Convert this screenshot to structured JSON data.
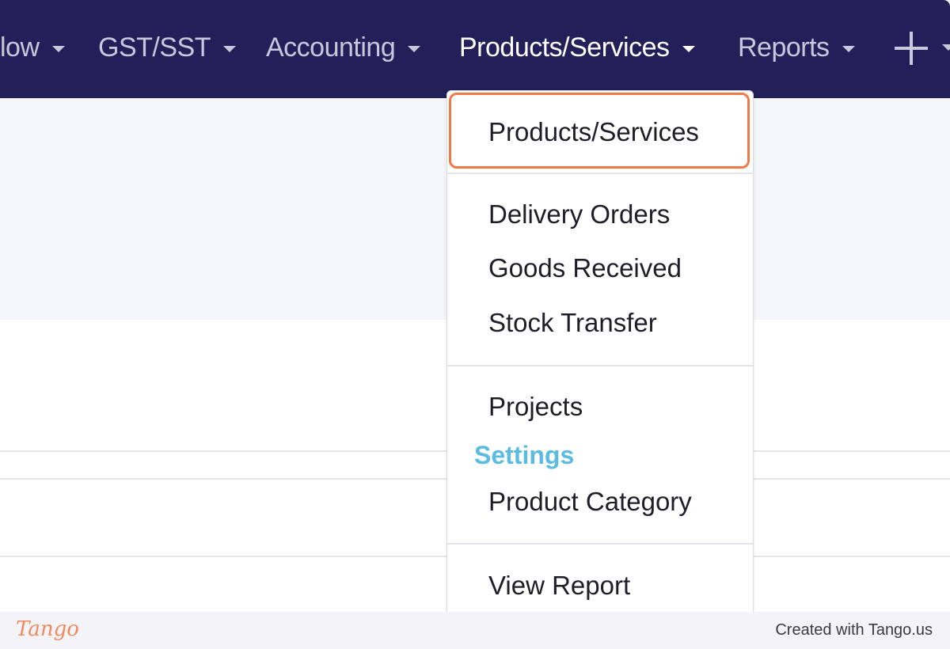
{
  "navbar": {
    "items": [
      {
        "label": "low",
        "active": false
      },
      {
        "label": "GST/SST",
        "active": false
      },
      {
        "label": "Accounting",
        "active": false
      },
      {
        "label": "Products/Services",
        "active": true
      },
      {
        "label": "Reports",
        "active": false
      }
    ],
    "add_icon": "plus-icon"
  },
  "dropdown": {
    "items": [
      "Products/Services",
      "Delivery Orders",
      "Goods Received",
      "Stock Transfer",
      "Projects"
    ],
    "settings_header": "Settings",
    "settings_items": [
      "Product Category"
    ],
    "report_item": "View Report"
  },
  "colors": {
    "navbar": "#221f59",
    "highlight": "#f07a45",
    "settings_header": "#5bbbe0"
  },
  "footer": {
    "logo": "Tango",
    "text": "Created with Tango.us"
  }
}
